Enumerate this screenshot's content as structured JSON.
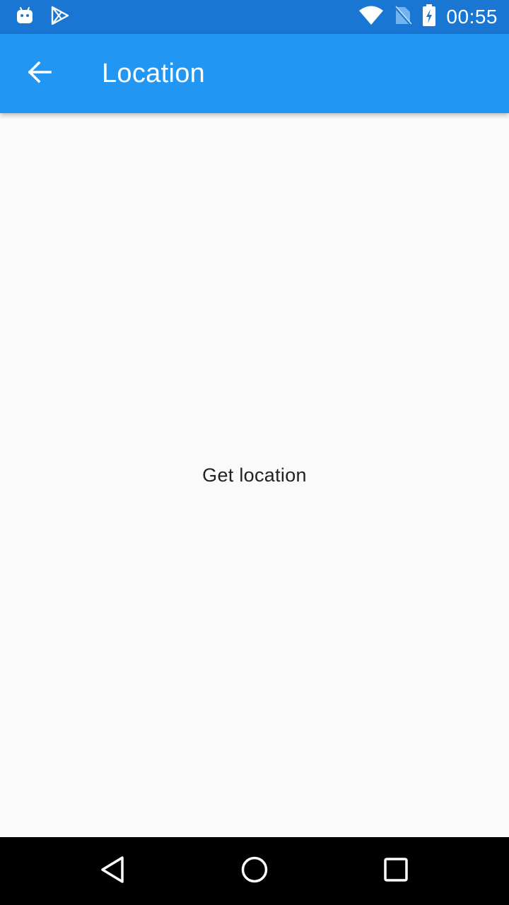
{
  "status_bar": {
    "time": "00:55",
    "icons": [
      "android-notification-icon",
      "play-store-icon",
      "wifi-icon",
      "no-sim-icon",
      "battery-charging-icon"
    ],
    "background_color": "#1976d2"
  },
  "app_bar": {
    "title": "Location",
    "back_icon": "arrow-back-icon",
    "background_color": "#2196f3"
  },
  "main": {
    "get_location_label": "Get location"
  },
  "nav_bar": {
    "icons": [
      "nav-back-icon",
      "nav-home-icon",
      "nav-recents-icon"
    ]
  }
}
